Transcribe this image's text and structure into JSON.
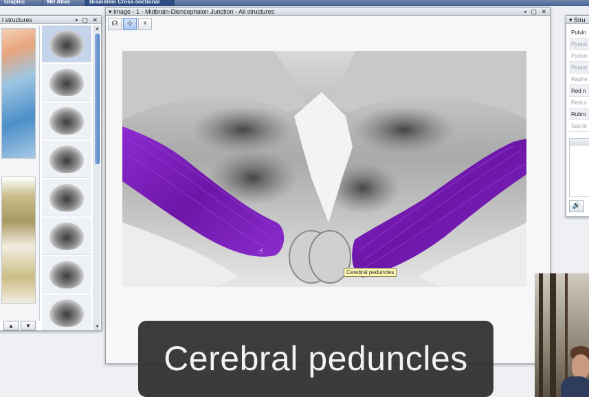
{
  "topbar": {
    "tabs": [
      {
        "label": "Graphic Atlas",
        "active": false
      },
      {
        "label": "MR Atlas",
        "active": false
      },
      {
        "label": "Brainstem Cross-Sectional Atlas",
        "active": true
      }
    ]
  },
  "left_panel": {
    "title": "l structures",
    "controls": "▪ ▢ ✕",
    "nav_up": "▲",
    "nav_down": "▼",
    "scroll_up": "▲",
    "scroll_down": "▼"
  },
  "image_window": {
    "title": "Image - 1 - Midbrain-Diencephalon Junction - All structures",
    "menu_arrow": "▾",
    "controls": "▪ ▢ ✕",
    "tools": [
      "☊",
      "⊹",
      "+"
    ],
    "tooltip": "Cerebral peduncles",
    "highlight_color": "#7a1fb8"
  },
  "right_panel": {
    "title": "Stru",
    "menu_arrow": "▾",
    "items": [
      {
        "label": "Pulvin",
        "dim": false
      },
      {
        "label": "Pyram",
        "dim": true
      },
      {
        "label": "Pyram",
        "dim": true
      },
      {
        "label": "Pyram",
        "dim": true
      },
      {
        "label": "Raphe",
        "dim": true
      },
      {
        "label": "Red n",
        "dim": false
      },
      {
        "label": "Reticu",
        "dim": true
      },
      {
        "label": "Rubro",
        "dim": false
      },
      {
        "label": "Sacral",
        "dim": true
      }
    ],
    "speaker": "🔊"
  },
  "caption": {
    "text": "Cerebral peduncles"
  }
}
